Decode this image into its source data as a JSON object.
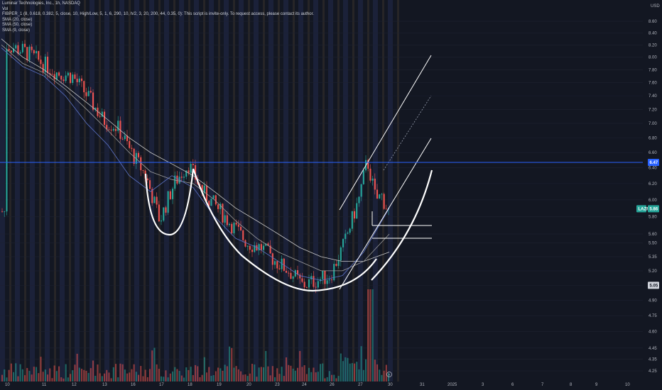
{
  "header": {
    "symbol_line": "Luminar Technologies, Inc., 1h, NASDAQ",
    "indicator_1": "Vol",
    "indicator_2": "FIBPER_1 (8, 0.618, 0.382, 5, close, 10, High/Low, 5, 1, 6, 290, 10, h/2, 3, 20, 200, 44, 0.35, 0): This script is invite-only. To request access, please contact its author.",
    "indicator_3": "SMA (20, close)",
    "indicator_4": "SMA (50, close)",
    "indicator_5": "SMA (9, close)"
  },
  "currency": "USD",
  "price_badges": {
    "level_line": "6.47",
    "ticker_label": "LAZR",
    "last_price": "5.86",
    "low_marker": "5.05"
  },
  "colors": {
    "background": "#131722",
    "up": "#26a69a",
    "down": "#ef5350",
    "level_line": "#2962ff",
    "sma": "#c7c7c7",
    "sma_blue": "#2962ff",
    "pattern": "#ffffff"
  },
  "chart_data": {
    "type": "candlestick",
    "title": "Luminar Technologies, Inc., 1h, NASDAQ",
    "y_axis": {
      "ticks": [
        "8.60",
        "8.40",
        "8.20",
        "8.00",
        "7.80",
        "7.60",
        "7.40",
        "7.20",
        "7.00",
        "6.80",
        "6.60",
        "6.40",
        "6.20",
        "6.00",
        "5.80",
        "5.60",
        "5.50",
        "5.35",
        "5.20",
        "5.05",
        "4.90",
        "4.75",
        "4.60",
        "4.45",
        "4.35",
        "4.25"
      ],
      "scale": "log",
      "range": [
        4.2,
        8.8
      ]
    },
    "x_axis": {
      "ticks": [
        "10",
        "11",
        "12",
        "13",
        "16",
        "17",
        "18",
        "19",
        "20",
        "23",
        "24",
        "26",
        "27",
        "30",
        "31",
        "2025",
        "3",
        "6",
        "7",
        "8",
        "9",
        "10"
      ]
    },
    "horizontal_level": 6.47,
    "last_price": 5.86,
    "price_path": [
      {
        "t": "10",
        "p": 8.2
      },
      {
        "t": "10.5",
        "p": 8.1
      },
      {
        "t": "11",
        "p": 7.9
      },
      {
        "t": "11.5",
        "p": 7.75
      },
      {
        "t": "12",
        "p": 7.7
      },
      {
        "t": "12.5",
        "p": 7.4
      },
      {
        "t": "13",
        "p": 7.05
      },
      {
        "t": "13.5",
        "p": 6.95
      },
      {
        "t": "16",
        "p": 6.6
      },
      {
        "t": "16.5",
        "p": 6.3
      },
      {
        "t": "17",
        "p": 5.75
      },
      {
        "t": "17.5",
        "p": 6.2
      },
      {
        "t": "18",
        "p": 6.45
      },
      {
        "t": "18.5",
        "p": 6.1
      },
      {
        "t": "19",
        "p": 5.9
      },
      {
        "t": "19.5",
        "p": 5.7
      },
      {
        "t": "20",
        "p": 5.5
      },
      {
        "t": "20.5",
        "p": 5.45
      },
      {
        "t": "23",
        "p": 5.3
      },
      {
        "t": "23.5",
        "p": 5.2
      },
      {
        "t": "24",
        "p": 5.05
      },
      {
        "t": "24.5",
        "p": 5.1
      },
      {
        "t": "26",
        "p": 5.15
      },
      {
        "t": "26.5",
        "p": 5.5
      },
      {
        "t": "27",
        "p": 6.0
      },
      {
        "t": "27.3",
        "p": 6.5
      },
      {
        "t": "27.6",
        "p": 6.0
      },
      {
        "t": "27.8",
        "p": 6.05
      },
      {
        "t": "30",
        "p": 5.86
      }
    ],
    "sma_lines": [
      {
        "name": "SMA (50, close)",
        "values": [
          8.3,
          8.0,
          7.8,
          7.55,
          7.3,
          7.05,
          6.8,
          6.6,
          6.45,
          6.3,
          6.1,
          5.9,
          5.75,
          5.6,
          5.45,
          5.35,
          5.3,
          5.3,
          5.4
        ]
      },
      {
        "name": "SMA (20, close)",
        "values": [
          8.2,
          7.9,
          7.75,
          7.5,
          7.2,
          6.9,
          6.6,
          6.35,
          6.25,
          6.2,
          6.0,
          5.75,
          5.55,
          5.4,
          5.3,
          5.2,
          5.2,
          5.3,
          5.6
        ]
      },
      {
        "name": "SMA (9, close)",
        "values": [
          8.15,
          7.85,
          7.7,
          7.4,
          7.0,
          6.7,
          6.3,
          6.1,
          6.3,
          6.15,
          5.8,
          5.55,
          5.45,
          5.3,
          5.15,
          5.1,
          5.15,
          5.4,
          5.9
        ]
      }
    ]
  }
}
